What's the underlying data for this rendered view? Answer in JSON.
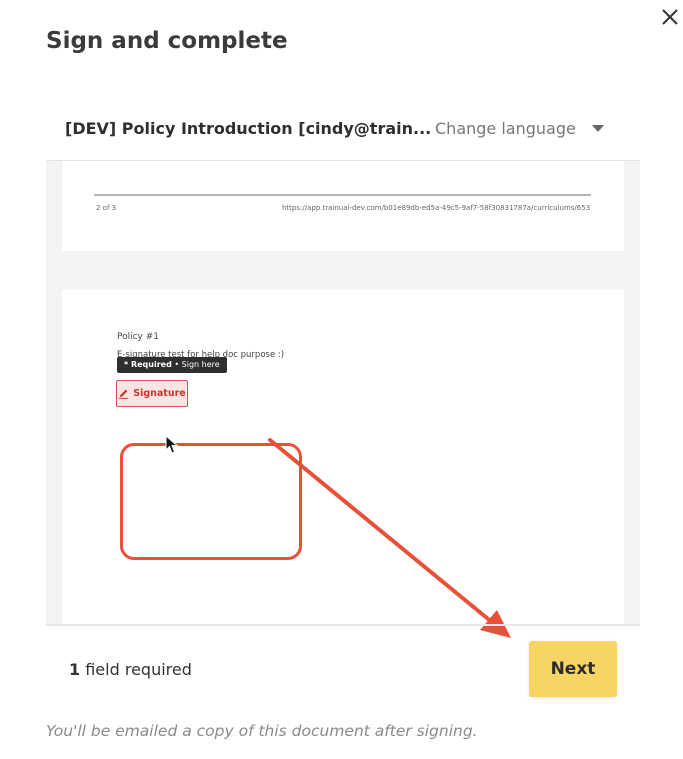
{
  "modal": {
    "title": "Sign and complete"
  },
  "document": {
    "name": "[DEV] Policy Introduction [cindy@train...",
    "language_label": "Change language"
  },
  "viewer": {
    "page1": {
      "page_number": "2 of 3",
      "url": "https://app.trainual-dev.com/b01e89db-ed5a-49c5-9af7-58f30831787a/curriculums/6537"
    },
    "page2": {
      "policy_title": "Policy #1",
      "policy_description": "E-signature test for help doc purpose :)",
      "tooltip_required": "* Required",
      "tooltip_separator": " • ",
      "tooltip_action": "Sign here",
      "signature_button": "Signature"
    }
  },
  "footer": {
    "required_count": "1",
    "required_text": " field required",
    "next_button": "Next",
    "email_note": "You'll be emailed a copy of this document after signing."
  },
  "colors": {
    "accent_button": "#f7d565",
    "highlight": "#e8503a",
    "signature_bg": "#fde3e3"
  }
}
